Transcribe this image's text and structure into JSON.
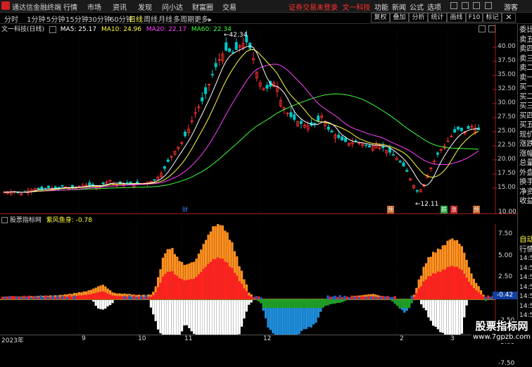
{
  "topbar": {
    "app_title": "通达信金融终端",
    "menus": [
      "行情",
      "市场",
      "资讯",
      "发现",
      "问小达",
      "财富圈",
      "交易"
    ],
    "login_text": "证券交易未登录",
    "stock_name": "文一科技",
    "right_menus": [
      "功能",
      "新闻",
      "公式",
      "选项"
    ],
    "guest": "游客"
  },
  "toolbar": {
    "periods": [
      "分时",
      "1分钟",
      "5分钟",
      "15分钟",
      "30分钟",
      "60分钟",
      "日线",
      "周线",
      "月线",
      "多周期",
      "更多"
    ],
    "active_period": "日线",
    "buttons": [
      "复权",
      "叠加",
      "分析",
      "统计",
      "画线",
      "F10",
      "标记"
    ]
  },
  "main_header": {
    "title": "文一科技(日线)",
    "ma5": "MA5: 25.17",
    "ma10": "MA10: 24.96",
    "ma20": "MA20: 22.17",
    "ma60": "MA60: 22.34"
  },
  "sub_header": {
    "source": "股票指标网",
    "indicator": "紫风鱼身: -0.78"
  },
  "annotations": {
    "high": "42.34",
    "low": "12.11",
    "current_value": "-0.42",
    "markers": [
      "财",
      "预",
      "跌",
      "涨",
      "预"
    ]
  },
  "side_panel": {
    "top_labels": [
      "委比",
      "卖五",
      "卖四",
      "卖三",
      "卖二",
      "卖一",
      "买一",
      "买二",
      "买三",
      "买四",
      "买五",
      "现价",
      "涨跌",
      "涨幅",
      "总量",
      "外盘",
      "换手",
      "净资",
      "收益"
    ],
    "bottom_labels": [
      "自动",
      "行情",
      "14:50",
      "14:50",
      "14:50",
      "14:50",
      "14:50",
      "14:50",
      "14:50",
      "14:50",
      "14:50"
    ]
  },
  "main_y_labels": [
    "40.00",
    "37.50",
    "35.00",
    "32.50",
    "30.00",
    "27.50",
    "25.00",
    "22.50",
    "20.00",
    "17.50",
    "15.00"
  ],
  "sub_y_labels": [
    "10.00",
    "7.50",
    "5.00",
    "2.50",
    "-2.50",
    "-5.00",
    "-7.50"
  ],
  "x_labels": [
    "2023年",
    "9",
    "10",
    "11",
    "12",
    "2",
    "3"
  ],
  "watermark": {
    "title": "股票指标网",
    "url": "www.7gpzb.com"
  },
  "colors": {
    "up": "#ff3030",
    "down": "#00c8c8",
    "ma5": "#ffffff",
    "ma10": "#ffff40",
    "ma20": "#ff40ff",
    "ma60": "#40ff40",
    "orange": "#ff9020",
    "red": "#ff2020",
    "green": "#20a020",
    "blue": "#2090e0"
  }
}
